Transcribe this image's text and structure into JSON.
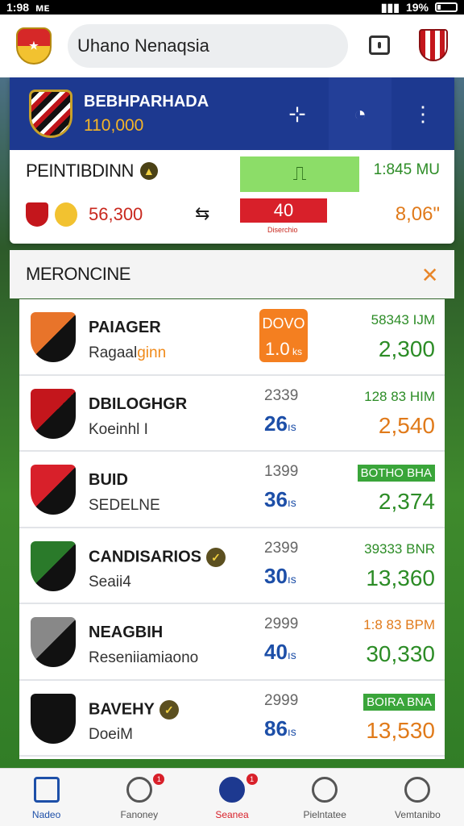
{
  "status": {
    "time": "1:98",
    "icons_left": "ᴍᴇ",
    "battery": "19%"
  },
  "header": {
    "search_text": "Uhano Nenaqsia"
  },
  "team": {
    "name": "BEBHPARHADA",
    "value": "110,000"
  },
  "primary": {
    "title": "PEINTIBDINN",
    "time": "1:845 MU",
    "left_value": "56,300",
    "score": "40",
    "score_sub": "Diserchio",
    "right_value": "8,06\""
  },
  "list": {
    "title": "MERONCINE",
    "rows": [
      {
        "name": "PAIAGER",
        "sub": "Ragaal",
        "sub_hl": "ginn",
        "col1": "DOVO",
        "col2": "1.0",
        "col2_unit": "ks",
        "top_right": "58343 IJM",
        "value": "2,300",
        "logo_color": "#e8742a",
        "badge": true,
        "top_color": "#2c8c26",
        "val_color": "#2c8c26"
      },
      {
        "name": "DBILOGHGR",
        "sub": "Koeinhl I",
        "sub_hl": "",
        "col1": "2339",
        "col2": "26",
        "col2_unit": "ıs",
        "top_right": "128 83 HIM",
        "value": "2,540",
        "logo_color": "#c4161c",
        "badge": false,
        "top_color": "#2c8c26",
        "val_color": "#e07a1a"
      },
      {
        "name": "BUID",
        "sub": "SEDELNE",
        "sub_hl": "",
        "col1": "1399",
        "col2": "36",
        "col2_unit": "ıs",
        "top_right": "BOTHO BHA",
        "value": "2,374",
        "logo_color": "#d8202a",
        "badge": false,
        "top_color": "#fff",
        "val_color": "#2c8c26",
        "tag": true
      },
      {
        "name": "CANDISARIOS",
        "sub": "Seaii4",
        "sub_hl": "",
        "col1": "2399",
        "col2": "30",
        "col2_unit": "ıs",
        "top_right": "39333 BNR",
        "value": "13,360",
        "logo_color": "#2a7a2a",
        "badge": false,
        "top_color": "#2c8c26",
        "val_color": "#2c8c26",
        "check": true
      },
      {
        "name": "NEAGBIH",
        "sub": "Reseniiamiaono",
        "sub_hl": "",
        "col1": "2999",
        "col2": "40",
        "col2_unit": "ıs",
        "top_right": "1:8 83 BPM",
        "value": "30,330",
        "logo_color": "#888",
        "badge": false,
        "top_color": "#e07a1a",
        "val_color": "#2c8c26"
      },
      {
        "name": "BAVEHY",
        "sub": "DoeiM",
        "sub_hl": "",
        "col1": "2999",
        "col2": "86",
        "col2_unit": "ıs",
        "top_right": "BOIRA BNA",
        "value": "13,530",
        "logo_color": "#111",
        "badge": false,
        "top_color": "#fff",
        "val_color": "#e07a1a",
        "tag": true,
        "check": true
      }
    ]
  },
  "nav": [
    {
      "label": "Nadeo",
      "active": true
    },
    {
      "label": "Fanoney",
      "badge": "1"
    },
    {
      "label": "Seanea",
      "badge": "1",
      "active_red": true
    },
    {
      "label": "Pielntatee"
    },
    {
      "label": "Vemtanibo"
    }
  ]
}
